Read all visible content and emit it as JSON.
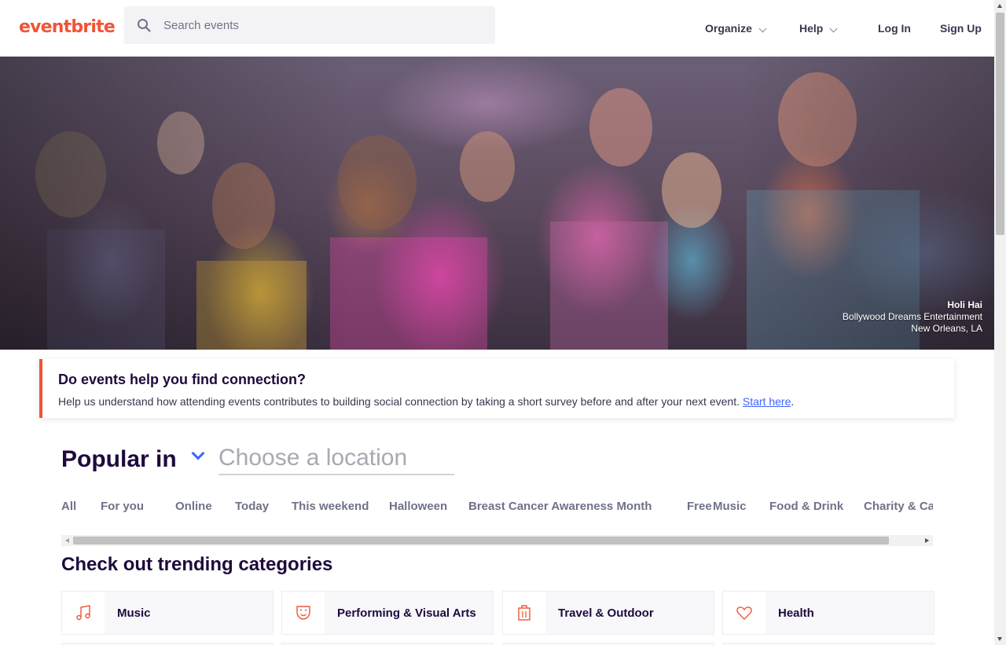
{
  "header": {
    "logo": "eventbrite",
    "search_placeholder": "Search events",
    "nav": {
      "organize": "Organize",
      "help": "Help",
      "login": "Log In",
      "signup": "Sign Up"
    }
  },
  "hero": {
    "event_title": "Holi Hai",
    "organizer": "Bollywood Dreams Entertainment",
    "location": "New Orleans, LA"
  },
  "survey": {
    "title": "Do events help you find connection?",
    "text": "Help us understand how attending events contributes to building social connection by taking a short survey before and after your next event.",
    "link": "Start here",
    "link_suffix": "."
  },
  "popular": {
    "label": "Popular in",
    "location_placeholder": "Choose a location"
  },
  "tabs": [
    "All",
    "For you",
    "Online",
    "Today",
    "This weekend",
    "Halloween",
    "Breast Cancer Awareness Month",
    "Free",
    "Music",
    "Food & Drink",
    "Charity & Causes"
  ],
  "trending": {
    "title": "Check out trending categories",
    "categories": [
      {
        "label": "Music",
        "icon": "music-note-icon"
      },
      {
        "label": "Performing & Visual Arts",
        "icon": "theater-mask-icon"
      },
      {
        "label": "Travel & Outdoor",
        "icon": "luggage-icon"
      },
      {
        "label": "Health",
        "icon": "heart-icon"
      }
    ]
  },
  "colors": {
    "brand": "#f05537",
    "text_dark": "#1e0a3c",
    "link": "#3d64ff"
  }
}
